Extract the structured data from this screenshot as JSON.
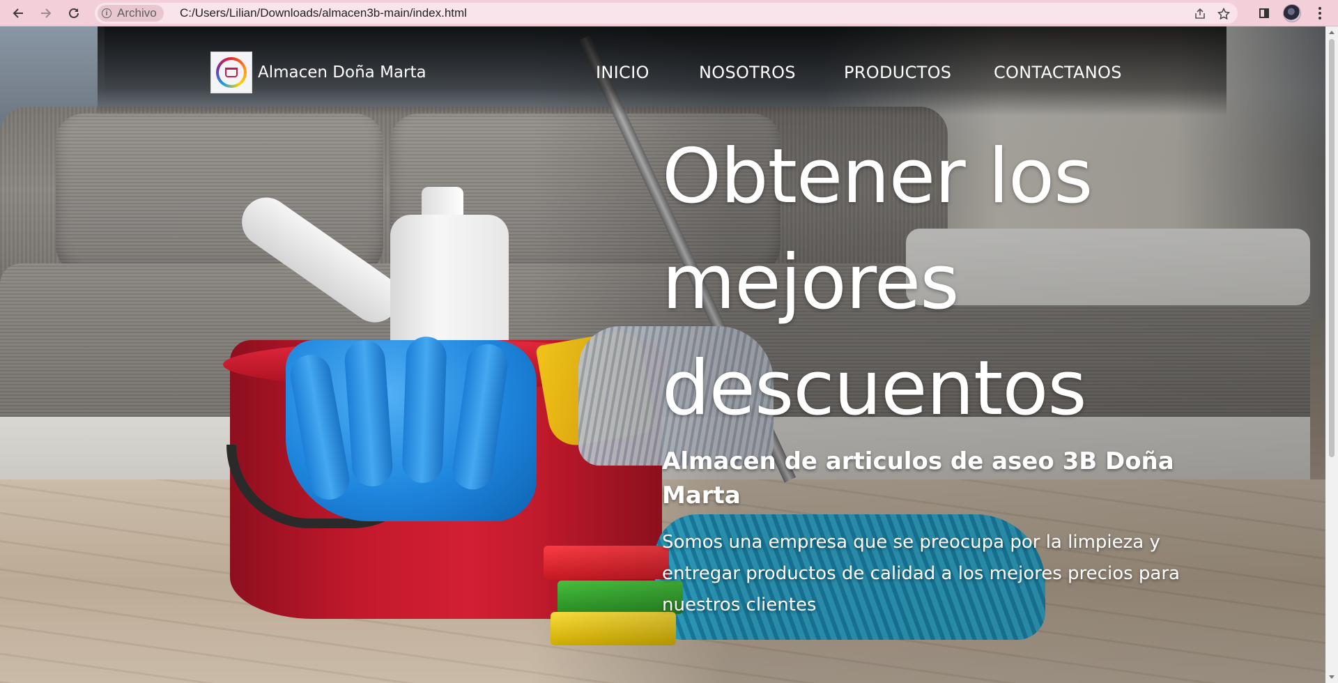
{
  "browser": {
    "chip_label": "Archivo",
    "url": "C:/Users/Lilian/Downloads/almacen3b-main/index.html",
    "icons": {
      "back": "arrow-left-icon",
      "forward": "arrow-right-icon",
      "reload": "reload-icon",
      "info": "info-icon",
      "share": "share-icon",
      "bookmark": "star-icon",
      "side_panel": "side-panel-icon",
      "profile": "profile-avatar",
      "menu": "kebab-menu-icon"
    },
    "colors": {
      "toolbar": "#f3cfd9",
      "omnibox": "#f8e4ea"
    }
  },
  "site": {
    "brand_name": "Almacen Doña Marta",
    "nav": [
      "INICIO",
      "NOSOTROS",
      "PRODUCTOS",
      "CONTACTANOS"
    ],
    "hero": {
      "title": "Obtener los mejores descuentos",
      "subtitle": "Almacen de articulos de aseo 3B Doña Marta",
      "description": "Somos una empresa que se preocupa por la limpieza y entregar productos de calidad a los mejores precios para nuestros clientes"
    },
    "colors": {
      "text": "#ffffff",
      "header_overlay": "#000000"
    }
  }
}
